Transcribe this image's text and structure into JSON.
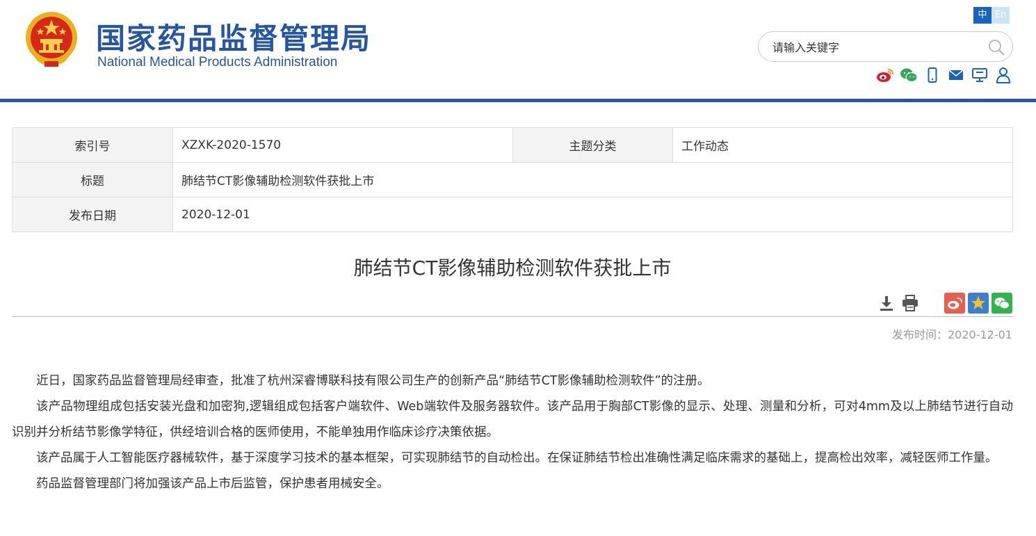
{
  "header": {
    "title_cn": "国家药品监督管理局",
    "title_en": "National Medical Products Administration",
    "lang_zh": "中",
    "lang_en": "En",
    "search_placeholder": "请输入关键字",
    "icons": [
      "weibo-icon",
      "wechat-icon",
      "mobile-icon",
      "mail-icon",
      "screen-icon",
      "user-icon"
    ],
    "brand_color": "#2456a6"
  },
  "meta": {
    "index_label": "索引号",
    "index_value": "XZXK-2020-1570",
    "category_label": "主题分类",
    "category_value": "工作动态",
    "title_label": "标题",
    "title_value": "肺结节CT影像辅助检测软件获批上市",
    "date_label": "发布日期",
    "date_value": "2020-12-01"
  },
  "article": {
    "title": "肺结节CT影像辅助检测软件获批上市",
    "pubtime": "发布时间：2020-12-01",
    "paragraphs": [
      "近日，国家药品监督管理局经审查，批准了杭州深睿博联科技有限公司生产的创新产品“肺结节CT影像辅助检测软件”的注册。",
      "该产品物理组成包括安装光盘和加密狗,逻辑组成包括客户端软件、Web端软件及服务器软件。该产品用于胸部CT影像的显示、处理、测量和分析，可对4mm及以上肺结节进行自动识别并分析结节影像学特征，供经培训合格的医师使用，不能单独用作临床诊疗决策依据。",
      "该产品属于人工智能医疗器械软件，基于深度学习技术的基本框架，可实现肺结节的自动检出。在保证肺结节检出准确性满足临床需求的基础上，提高检出效率，减轻医师工作量。",
      "药品监督管理部门将加强该产品上市后监管，保护患者用械安全。"
    ]
  }
}
